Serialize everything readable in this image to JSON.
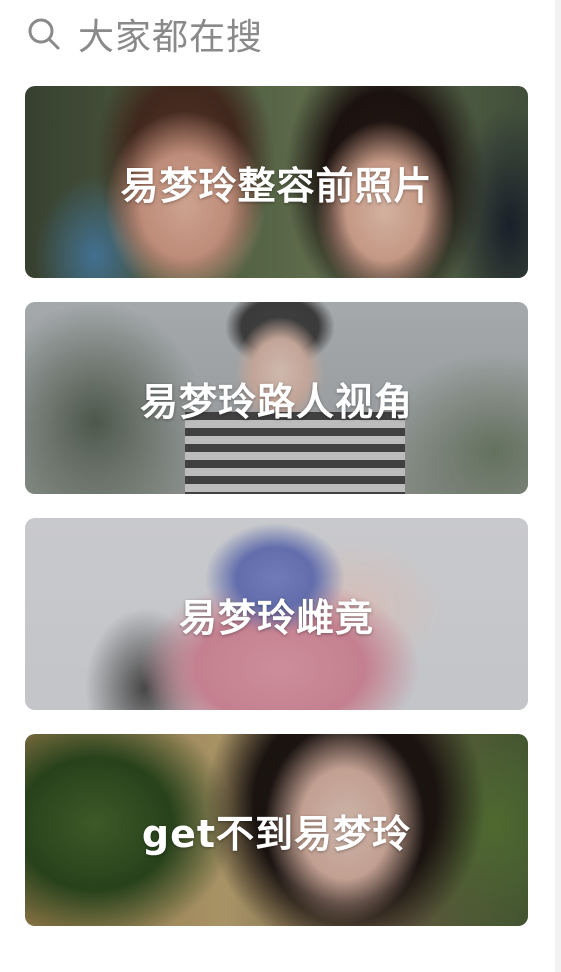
{
  "header": {
    "title": "大家都在搜",
    "icon": "search-icon"
  },
  "cards": [
    {
      "label": "易梦玲整容前照片"
    },
    {
      "label": "易梦玲路人视角"
    },
    {
      "label": "易梦玲雌竟"
    },
    {
      "label": "get不到易梦玲"
    }
  ]
}
